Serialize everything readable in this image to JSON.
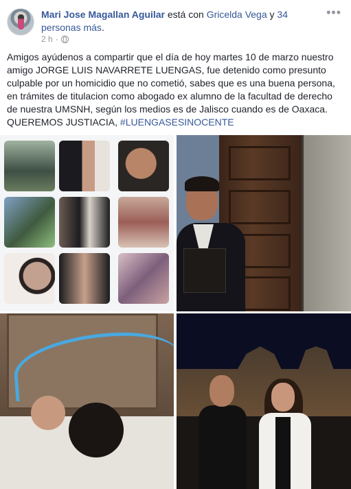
{
  "post": {
    "author_name": "Mari Jose Magallan Aguilar",
    "with_text": " está con ",
    "tagged_name": "Gricelda Vega",
    "and_text": " y ",
    "others_link": "34 personas más",
    "others_period": ".",
    "timestamp": "2 h",
    "separator": "·",
    "privacy_icon": "globe-icon",
    "more_icon": "more-options-icon",
    "more_label": "•••",
    "body_line_1": "Amigos ayúdenos a compartir que el día de hoy martes 10 de marzo nuestro",
    "body_line_2": "amigo JORGE LUIS NAVARRETE LUENGAS, fue detenido como presunto",
    "body_line_3": "culpable por un homicidio que no cometió, sabes que es una buena persona,",
    "body_line_4": "en trámites de titulacion como abogado ex alumno de la facultad de derecho",
    "body_line_5": "de nuestra UMSNH, según los medios es de Jalisco cuando es de Oaxaca.",
    "body_line_6_text": "QUEREMOS JUSTIACIA, ",
    "body_line_6_hashtag": "#LUENGASESINOCENTE"
  },
  "colors": {
    "link": "#365899",
    "text": "#1d2129",
    "meta": "#90949c",
    "annotation_line": "#4aa8e0"
  },
  "photos": [
    {
      "name": "photo-collage"
    },
    {
      "name": "photo-portrait-door"
    },
    {
      "name": "photo-crowd"
    },
    {
      "name": "photo-night-cathedral"
    }
  ]
}
